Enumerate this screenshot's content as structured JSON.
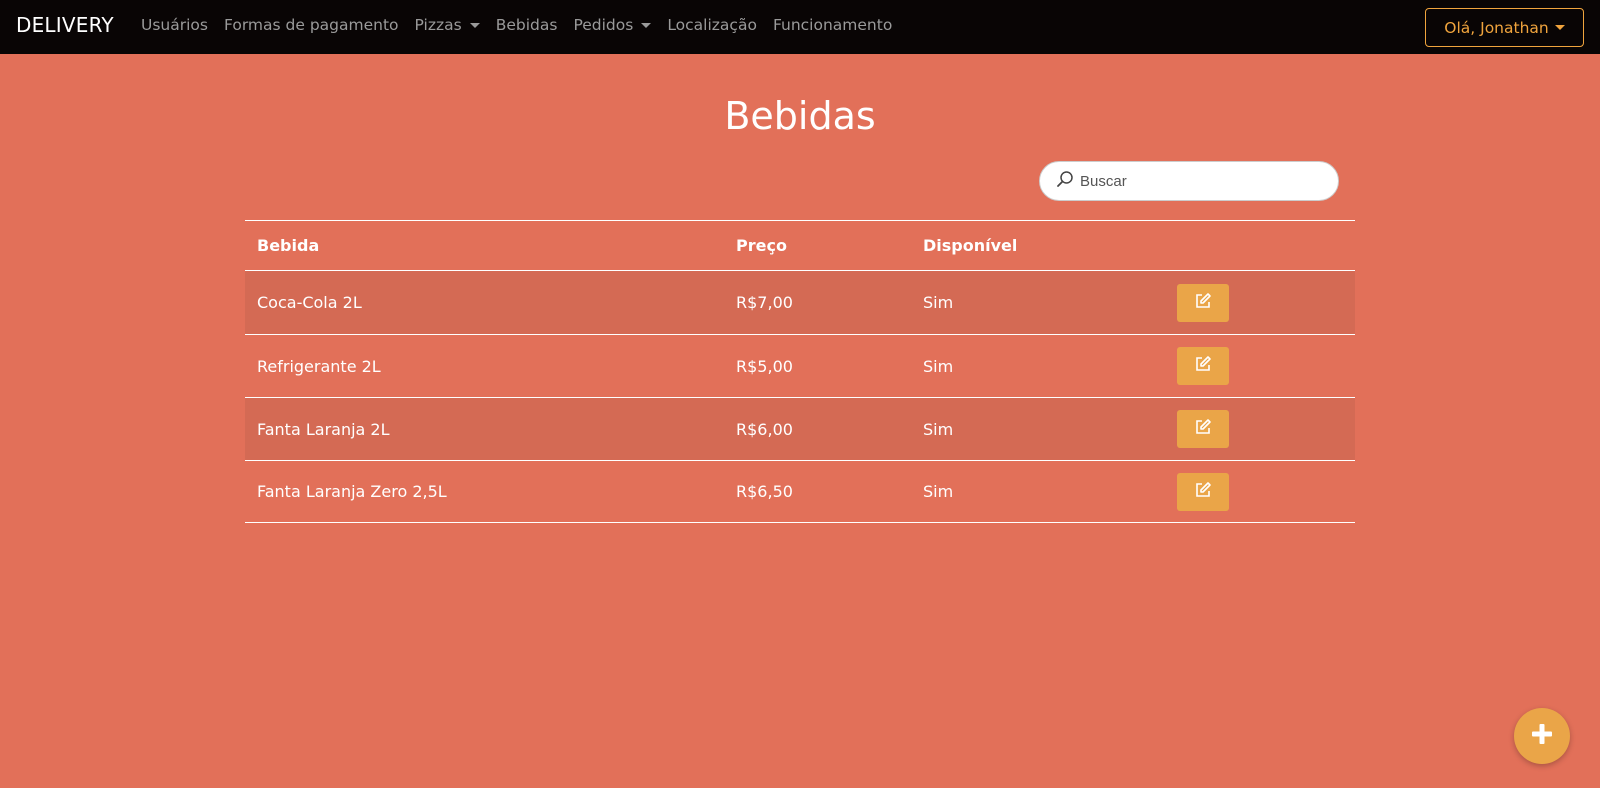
{
  "nav": {
    "brand": "DELIVERY",
    "links": [
      {
        "label": "Usuários",
        "dropdown": false
      },
      {
        "label": "Formas de pagamento",
        "dropdown": false
      },
      {
        "label": "Pizzas",
        "dropdown": true
      },
      {
        "label": "Bebidas",
        "dropdown": false
      },
      {
        "label": "Pedidos",
        "dropdown": true
      },
      {
        "label": "Localização",
        "dropdown": false
      },
      {
        "label": "Funcionamento",
        "dropdown": false
      }
    ],
    "user_label": "Olá, Jonathan"
  },
  "page": {
    "title": "Bebidas",
    "search_placeholder": "Buscar"
  },
  "table": {
    "headers": [
      "Bebida",
      "Preço",
      "Disponível",
      ""
    ],
    "rows": [
      {
        "bebida": "Coca-Cola 2L",
        "preco": "R$7,00",
        "disponivel": "Sim"
      },
      {
        "bebida": "Refrigerante 2L",
        "preco": "R$5,00",
        "disponivel": "Sim"
      },
      {
        "bebida": "Fanta Laranja 2L",
        "preco": "R$6,00",
        "disponivel": "Sim"
      },
      {
        "bebida": "Fanta Laranja Zero 2,5L",
        "preco": "R$6,50",
        "disponivel": "Sim"
      }
    ]
  },
  "icons": {
    "search": "search-icon",
    "edit": "edit-icon",
    "add": "plus-icon"
  },
  "colors": {
    "background": "#e27059",
    "navbar": "#090505",
    "accent": "#eaa548",
    "user_button": "#f0a43d",
    "striped_row": "#d46a54"
  }
}
